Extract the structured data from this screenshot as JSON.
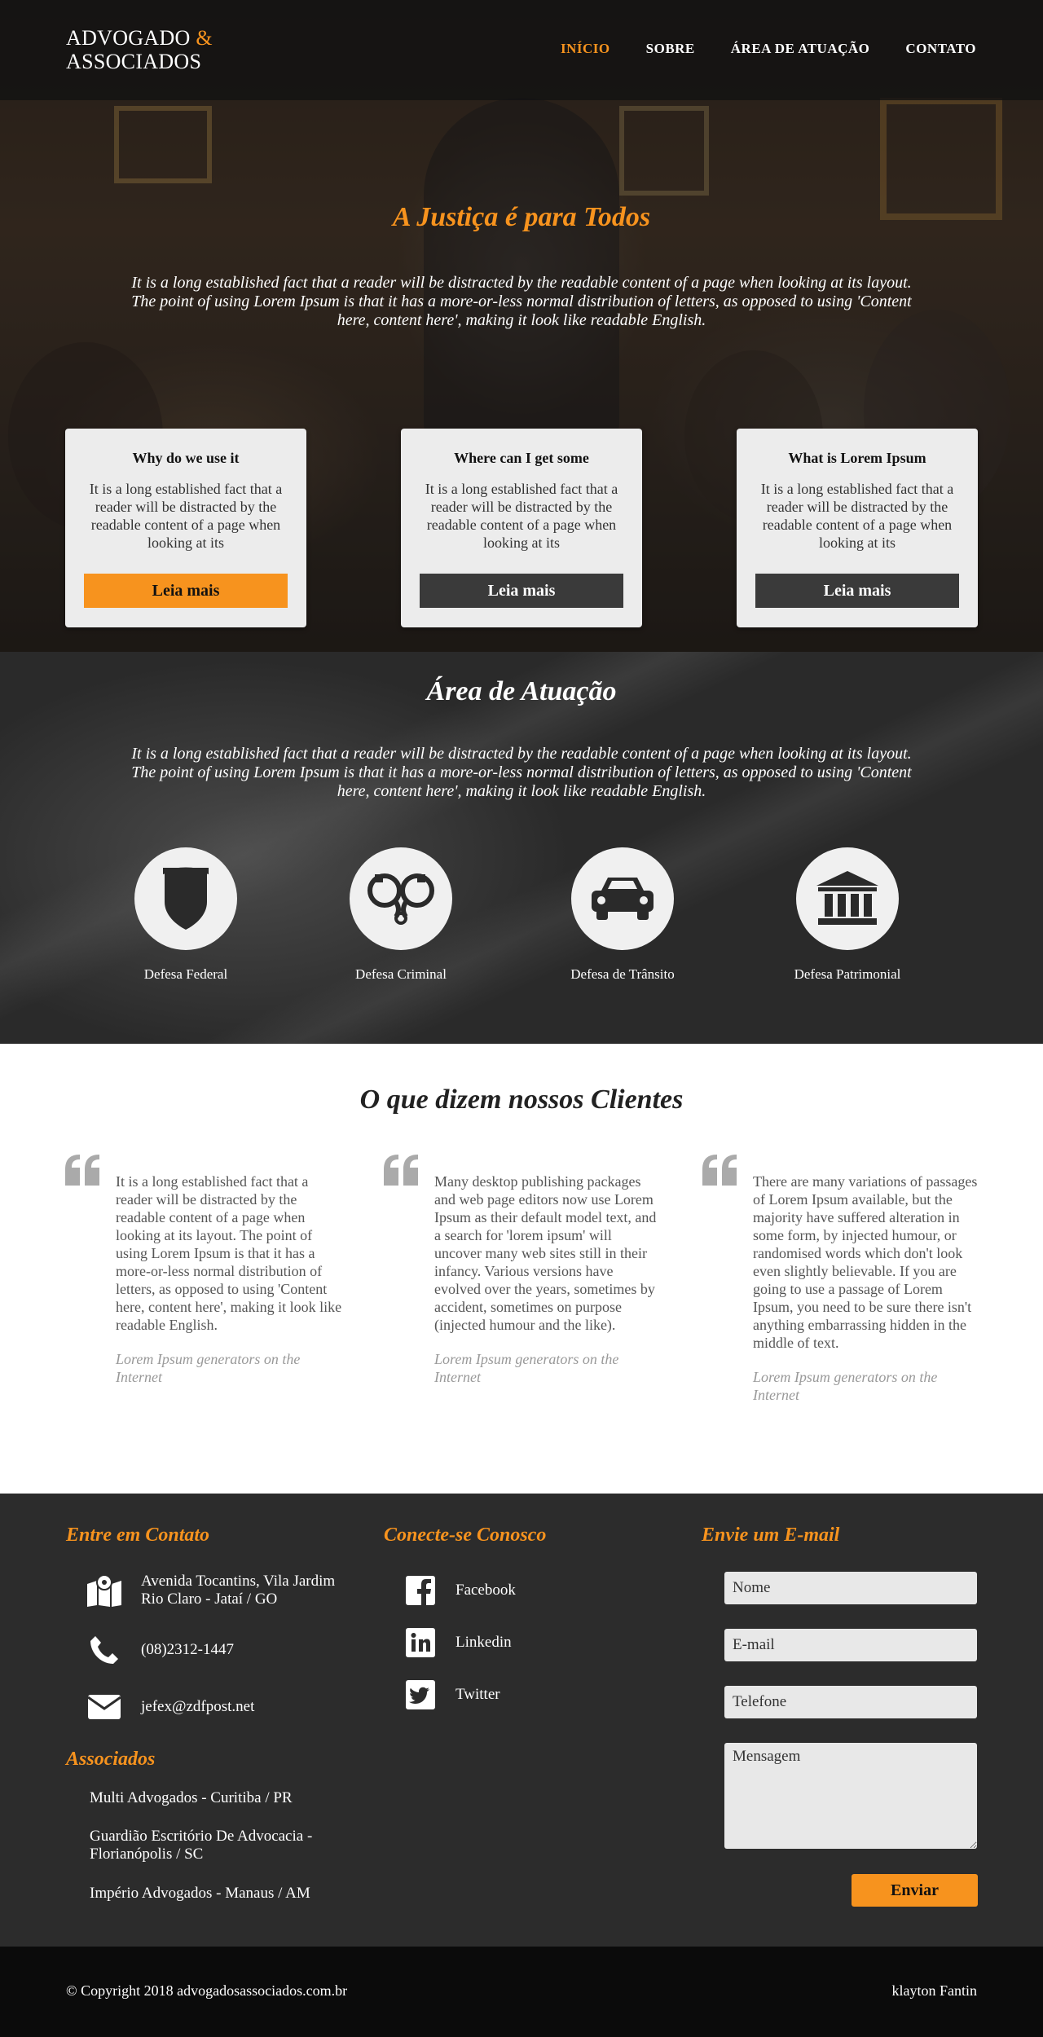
{
  "brand": {
    "line1": "ADVOGADO ",
    "amp": "&",
    "line2": "ASSOCIADOS"
  },
  "nav": [
    {
      "label": "INÍCIO",
      "active": true
    },
    {
      "label": "SOBRE"
    },
    {
      "label": "ÁREA DE ATUAÇÃO"
    },
    {
      "label": "CONTATO"
    }
  ],
  "hero": {
    "title": "A Justiça é para Todos",
    "text": "It is a long established fact that a reader will be distracted by the readable content of a page when looking at its layout. The point of using Lorem Ipsum is that it has a more-or-less normal distribution of letters, as opposed to using 'Content here, content here', making it look like readable English.",
    "cards": [
      {
        "title": "Why do we use it",
        "text": "It is a long established fact that a reader will be distracted by the readable content of a page when looking at its",
        "button": "Leia mais"
      },
      {
        "title": "Where can I get some",
        "text": "It is a long established fact that a reader will be distracted by the readable content of a page when looking at its",
        "button": "Leia mais"
      },
      {
        "title": "What is Lorem Ipsum",
        "text": "It is a long established fact that a reader will be distracted by the readable content of a page when looking at its",
        "button": "Leia mais"
      }
    ]
  },
  "area": {
    "title": "Área de Atuação",
    "text": "It is a long established fact that a reader will be distracted by the readable content of a page when looking at its layout. The point of using Lorem Ipsum is that it has a more-or-less normal distribution of letters, as opposed to using 'Content here, content here', making it look like readable English.",
    "services": [
      {
        "label": "Defesa Federal",
        "icon": "shield-icon"
      },
      {
        "label": "Defesa Criminal",
        "icon": "handcuffs-icon"
      },
      {
        "label": "Defesa de Trânsito",
        "icon": "car-icon"
      },
      {
        "label": "Defesa Patrimonial",
        "icon": "bank-icon"
      }
    ]
  },
  "clientes": {
    "title": "O que dizem nossos Clientes",
    "quotes": [
      {
        "text": "It is a long established fact that a reader will be distracted by the readable content of a page when looking at its layout. The point of using Lorem Ipsum is that it has a more-or-less normal distribution of letters, as opposed to using 'Content here, content here', making it look like readable English.",
        "author": "Lorem Ipsum generators on the Internet"
      },
      {
        "text": "Many desktop publishing packages and web page editors now use Lorem Ipsum as their default model text, and a search for 'lorem ipsum' will uncover many web sites still in their infancy. Various versions have evolved over the years, sometimes by accident, sometimes on purpose (injected humour and the like).",
        "author": "Lorem Ipsum generators on the Internet"
      },
      {
        "text": "There are many variations of passages of Lorem Ipsum available, but the majority have suffered alteration in some form, by injected humour, or randomised words which don't look even slightly believable. If you are going to use a passage of Lorem Ipsum, you need to be sure there isn't anything embarrassing hidden in the middle of text.",
        "author": "Lorem Ipsum generators on the Internet"
      }
    ]
  },
  "footer": {
    "contact_title": "Entre em Contato",
    "address": "Avenida Tocantins, Vila Jardim Rio Claro - Jataí / GO",
    "phone": "(08)2312-1447",
    "email": "jefex@zdfpost.net",
    "social_title": "Conecte-se Conosco",
    "social": [
      "Facebook",
      "Linkedin",
      "Twitter"
    ],
    "associados_title": "Associados",
    "associados": [
      "Multi Advogados - Curitiba / PR",
      "Guardião Escritório De Advocacia - Florianópolis / SC",
      "Império Advogados - Manaus / AM"
    ],
    "form_title": "Envie um E-mail",
    "form": {
      "name": "Nome",
      "email": "E-mail",
      "phone": "Telefone",
      "message": "Mensagem",
      "submit": "Enviar"
    }
  },
  "bottom": {
    "copyright": "© Copyright 2018 advogadosassociados.com.br",
    "author": "klayton Fantin"
  },
  "colors": {
    "accent": "#f7931e",
    "dark": "#2c2c2c",
    "card_button": "#3a3a3a"
  }
}
